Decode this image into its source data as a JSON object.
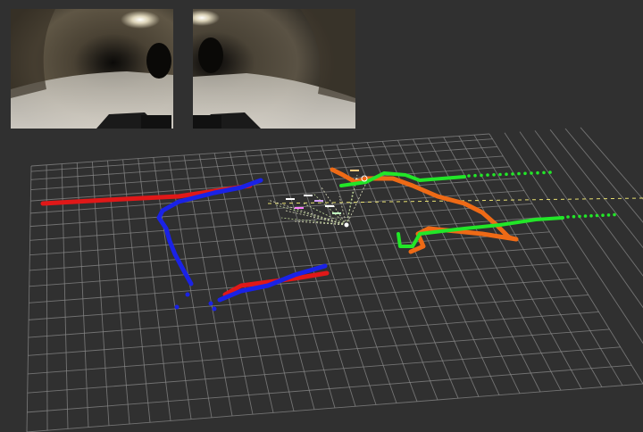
{
  "scene": {
    "background_color": "#303030",
    "grid_color": "#8a8a8a",
    "cameras": [
      {
        "name": "camera-left-feed",
        "view": "tunnel",
        "light": "overhead-lamp"
      },
      {
        "name": "camera-right-feed",
        "view": "tunnel",
        "light": "overhead-lamp"
      }
    ],
    "trajectories": [
      {
        "name": "red",
        "color": "#e01818"
      },
      {
        "name": "blue",
        "color": "#1a22e6"
      },
      {
        "name": "orange",
        "color": "#ee6a16"
      },
      {
        "name": "green",
        "color": "#22e628"
      }
    ],
    "dashed_line_color": "#e8e070"
  }
}
